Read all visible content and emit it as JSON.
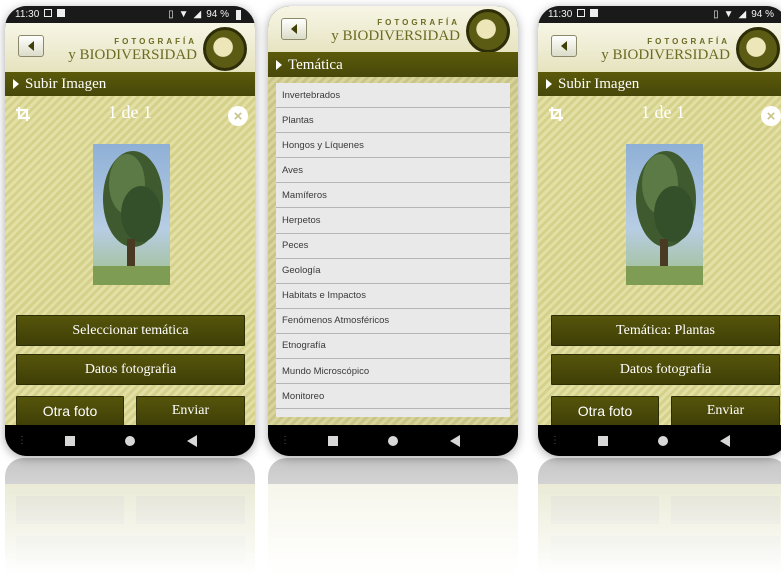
{
  "status": {
    "time": "11:30",
    "battery": "94 %"
  },
  "brand": {
    "line1": "FOTOGRAFÍA",
    "line2": "y BIODIVERSIDAD"
  },
  "screen1": {
    "section_title": "Subir Imagen",
    "counter": "1 de 1",
    "select_topic_label": "Seleccionar temática",
    "photo_data_label": "Datos fotografia",
    "another_photo_label": "Otra foto",
    "send_label": "Enviar"
  },
  "screen2": {
    "section_title": "Temática",
    "topics": [
      "Invertebrados",
      "Plantas",
      "Hongos y Líquenes",
      "Aves",
      "Mamíferos",
      "Herpetos",
      "Peces",
      "Geología",
      "Habitats e Impactos",
      "Fenómenos Atmosféricos",
      "Etnografía",
      "Mundo Microscópico",
      "Monitoreo"
    ]
  },
  "screen3": {
    "section_title": "Subir Imagen",
    "counter": "1 de 1",
    "topic_label": "Temática: Plantas",
    "photo_data_label": "Datos fotografia",
    "another_photo_label": "Otra foto",
    "send_label": "Enviar"
  },
  "colors": {
    "olive": "#4f4f0a",
    "light_olive": "#d9d596",
    "header_bg": "#f2f0d8"
  },
  "icons": [
    "back-arrow-icon",
    "crop-icon",
    "close-icon",
    "logo-icon",
    "menu-dots-icon",
    "home-square-icon",
    "home-circle-icon",
    "back-triangle-icon"
  ]
}
